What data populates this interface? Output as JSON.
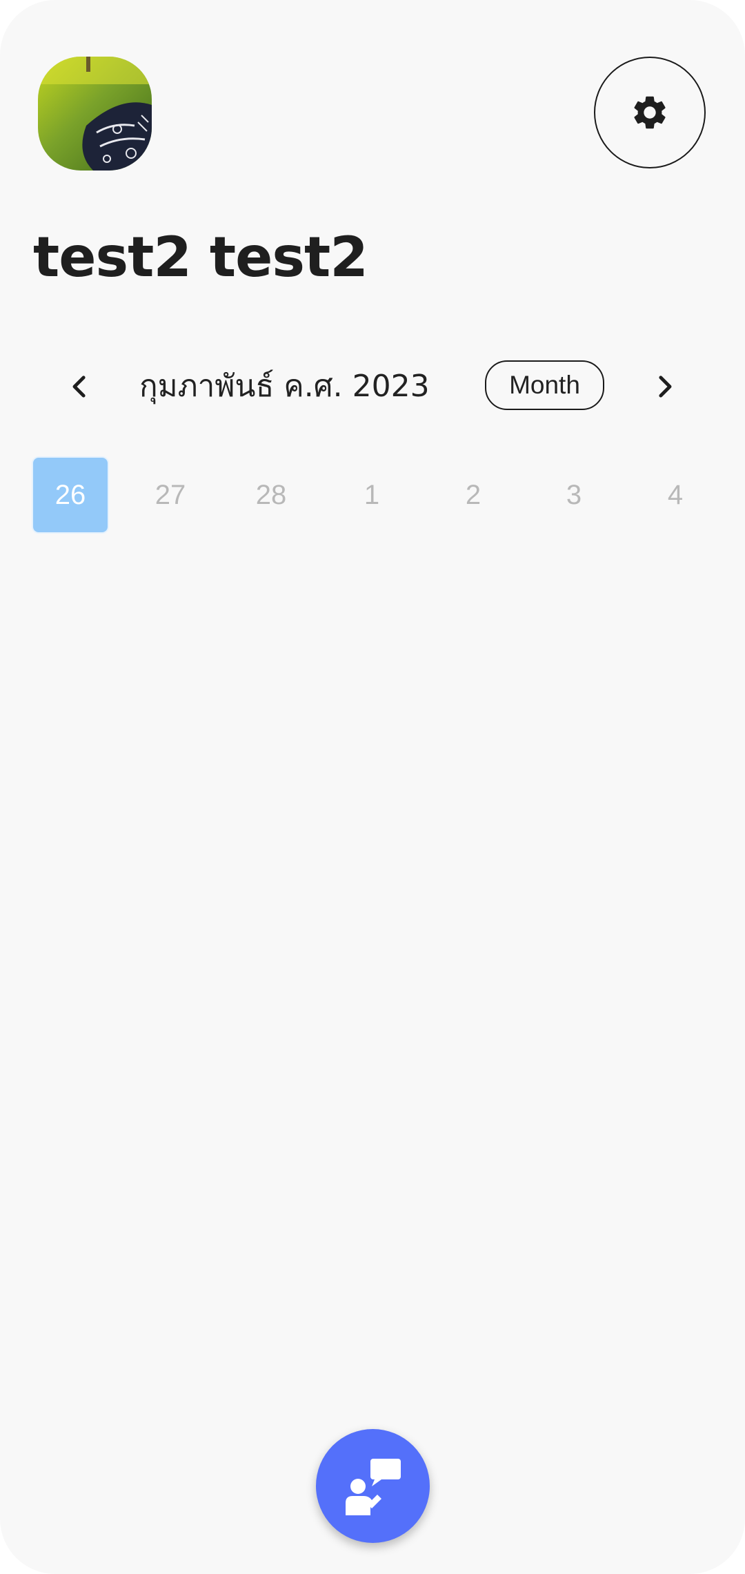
{
  "header": {
    "user_name": "test2 test2",
    "avatar_icon": "profile-photo",
    "settings_icon": "gear-icon"
  },
  "calendar": {
    "month_label": "กุมภาพันธ์ ค.ศ. 2023",
    "view_mode_label": "Month",
    "prev_icon": "chevron-left-icon",
    "next_icon": "chevron-right-icon",
    "days": [
      "26",
      "27",
      "28",
      "1",
      "2",
      "3",
      "4"
    ],
    "selected_day": "26",
    "selected_color": "#93c9f9"
  },
  "fab": {
    "icon": "consult-chat-icon",
    "color": "#5470fa"
  }
}
